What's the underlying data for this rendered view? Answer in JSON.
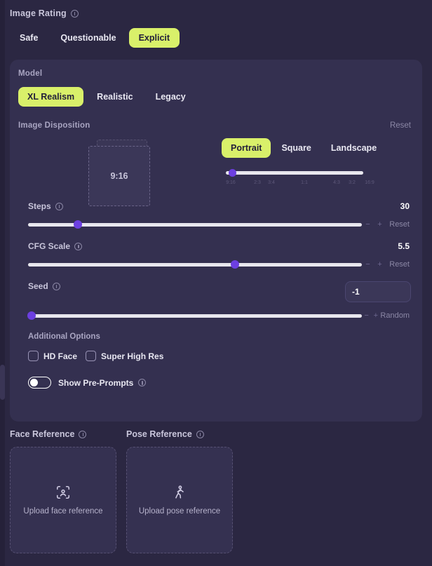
{
  "theme": {
    "page_bg": "#2b2742",
    "card_bg": "#343050",
    "accent": "#d9f06a",
    "knob": "#6c3fe0",
    "track": "#e8e7ee",
    "muted_text": "#8b87a5"
  },
  "rating": {
    "label": "Image Rating",
    "info_icon": "info-icon",
    "options": [
      {
        "label": "Safe",
        "selected": false
      },
      {
        "label": "Questionable",
        "selected": false
      },
      {
        "label": "Explicit",
        "selected": true
      }
    ]
  },
  "model": {
    "label": "Model",
    "options": [
      {
        "label": "XL Realism",
        "selected": true
      },
      {
        "label": "Realistic",
        "selected": false
      },
      {
        "label": "Legacy",
        "selected": false
      }
    ]
  },
  "disposition": {
    "label": "Image Disposition",
    "reset_label": "Reset",
    "preview_ratio": "9:16",
    "orientations": [
      {
        "label": "Portrait",
        "selected": true
      },
      {
        "label": "Square",
        "selected": false
      },
      {
        "label": "Landscape",
        "selected": false
      }
    ],
    "ratio_ticks": [
      "9:16",
      "2:3",
      "3:4",
      "1:1",
      "4:3",
      "3:2",
      "16:9"
    ],
    "ratio_selected": "9:16",
    "ratio_knob_percent": 2
  },
  "steps": {
    "label": "Steps",
    "value": "30",
    "knob_percent": 15,
    "minus_label": "−",
    "plus_label": "+",
    "reset_label": "Reset"
  },
  "cfg": {
    "label": "CFG Scale",
    "value": "5.5",
    "knob_percent": 62,
    "minus_label": "−",
    "plus_label": "+",
    "reset_label": "Reset"
  },
  "seed": {
    "label": "Seed",
    "value": "-1",
    "placeholder": "-1",
    "knob_percent": 1,
    "minus_label": "−",
    "plus_label": "+",
    "random_label": "Random"
  },
  "additional": {
    "title": "Additional Options",
    "checkboxes": [
      {
        "label": "HD Face",
        "checked": false
      },
      {
        "label": "Super High Res",
        "checked": false
      }
    ],
    "toggle": {
      "label": "Show Pre-Prompts",
      "on": false
    }
  },
  "face_reference": {
    "label": "Face Reference",
    "upload_text": "Upload face reference",
    "icon": "scan-face-icon"
  },
  "pose_reference": {
    "label": "Pose Reference",
    "upload_text": "Upload pose reference",
    "icon": "walking-person-icon"
  }
}
